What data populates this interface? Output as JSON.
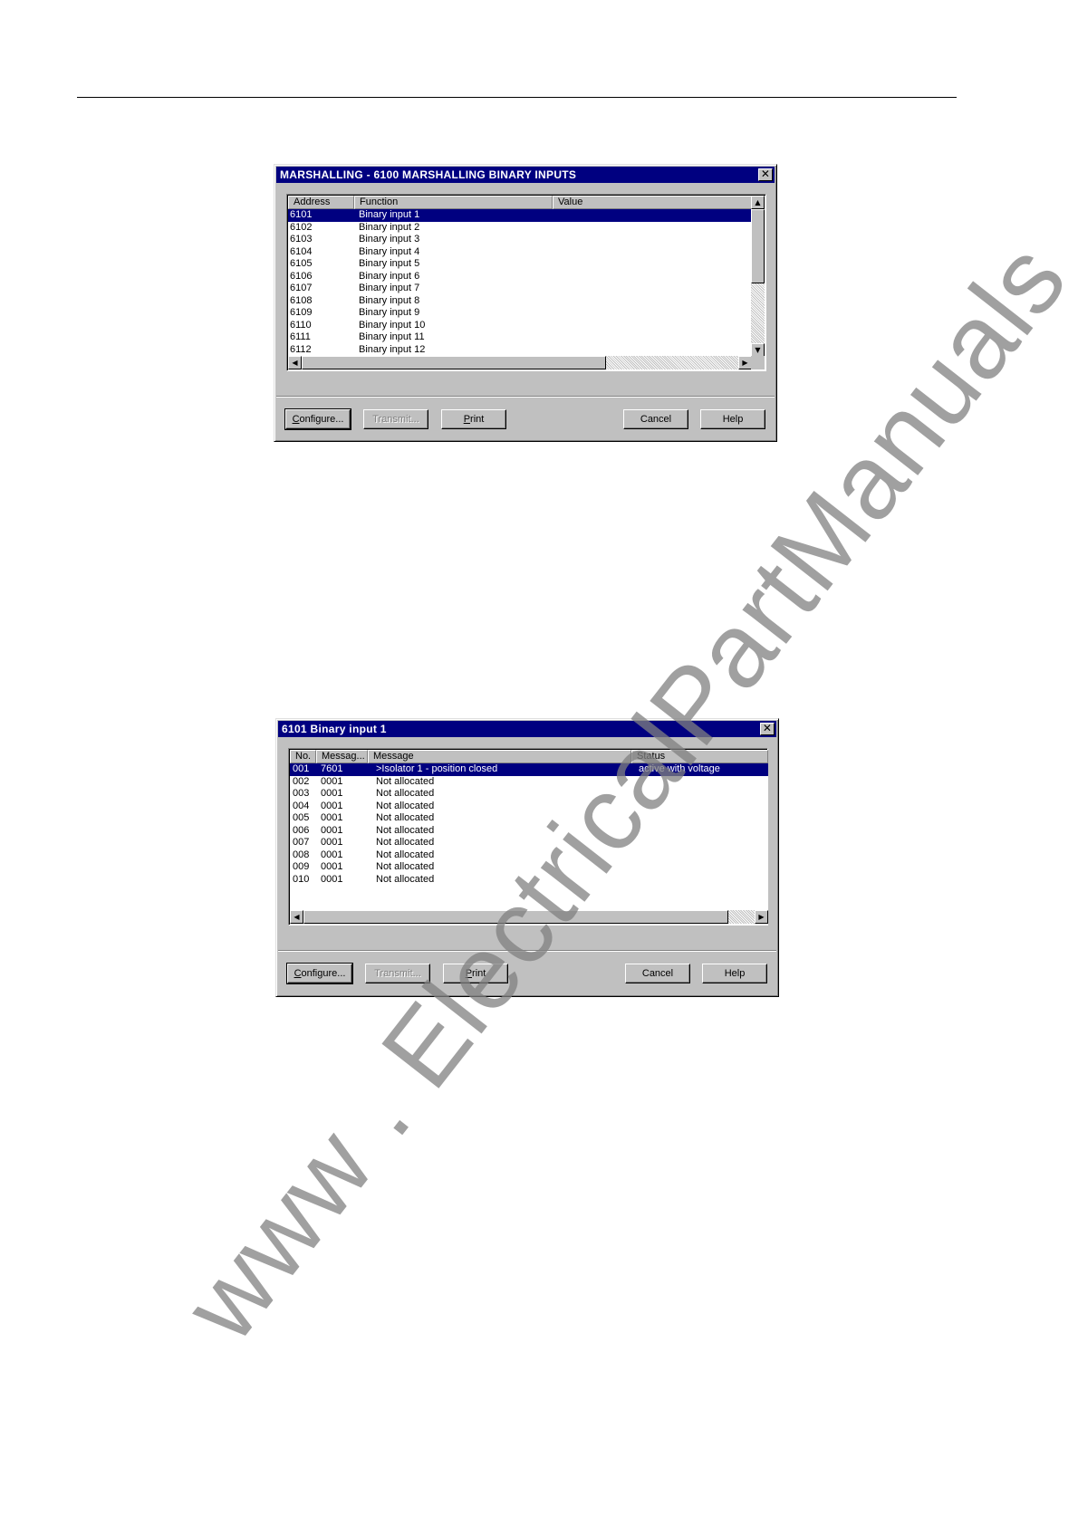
{
  "dialog1": {
    "title": "MARSHALLING - 6100  MARSHALLING BINARY INPUTS",
    "close_label": "✕",
    "columns": [
      "Address",
      "Function",
      "Value"
    ],
    "rows": [
      {
        "address": "6101",
        "function": "Binary input 1",
        "value": ""
      },
      {
        "address": "6102",
        "function": "Binary input 2",
        "value": ""
      },
      {
        "address": "6103",
        "function": "Binary input 3",
        "value": ""
      },
      {
        "address": "6104",
        "function": "Binary input 4",
        "value": ""
      },
      {
        "address": "6105",
        "function": "Binary input 5",
        "value": ""
      },
      {
        "address": "6106",
        "function": "Binary input 6",
        "value": ""
      },
      {
        "address": "6107",
        "function": "Binary input 7",
        "value": ""
      },
      {
        "address": "6108",
        "function": "Binary input 8",
        "value": ""
      },
      {
        "address": "6109",
        "function": "Binary input 9",
        "value": ""
      },
      {
        "address": "6110",
        "function": "Binary input 10",
        "value": ""
      },
      {
        "address": "6111",
        "function": "Binary input 11",
        "value": ""
      },
      {
        "address": "6112",
        "function": "Binary input 12",
        "value": ""
      }
    ],
    "selected_row": 0,
    "buttons": {
      "configure_pre": "C",
      "configure_post": "onfigure...",
      "transmit": "Transmit...",
      "print_pre": "P",
      "print_post": "rint",
      "cancel": "Cancel",
      "help": "Help"
    }
  },
  "dialog2": {
    "title": "6101 Binary input 1",
    "close_label": "✕",
    "columns": [
      "No.",
      "Messag...",
      "Message",
      "Status"
    ],
    "rows": [
      {
        "no": "001",
        "msg_no": "7601",
        "message": ">Isolator 1 - position closed",
        "status": "active with voltage"
      },
      {
        "no": "002",
        "msg_no": "0001",
        "message": "Not allocated",
        "status": ""
      },
      {
        "no": "003",
        "msg_no": "0001",
        "message": "Not allocated",
        "status": ""
      },
      {
        "no": "004",
        "msg_no": "0001",
        "message": "Not allocated",
        "status": ""
      },
      {
        "no": "005",
        "msg_no": "0001",
        "message": "Not allocated",
        "status": ""
      },
      {
        "no": "006",
        "msg_no": "0001",
        "message": "Not allocated",
        "status": ""
      },
      {
        "no": "007",
        "msg_no": "0001",
        "message": "Not allocated",
        "status": ""
      },
      {
        "no": "008",
        "msg_no": "0001",
        "message": "Not allocated",
        "status": ""
      },
      {
        "no": "009",
        "msg_no": "0001",
        "message": "Not allocated",
        "status": ""
      },
      {
        "no": "010",
        "msg_no": "0001",
        "message": "Not allocated",
        "status": ""
      }
    ],
    "selected_row": 0,
    "buttons": {
      "configure_pre": "C",
      "configure_post": "onfigure...",
      "transmit": "Transmit...",
      "print_pre": "P",
      "print_post": "rint",
      "cancel": "Cancel",
      "help": "Help"
    }
  },
  "watermark": "www . ElectricalPartManuals . com",
  "colors": {
    "titlebar": "#000080",
    "face": "#c0c0c0",
    "selection": "#000080",
    "watermark": "#808080"
  }
}
